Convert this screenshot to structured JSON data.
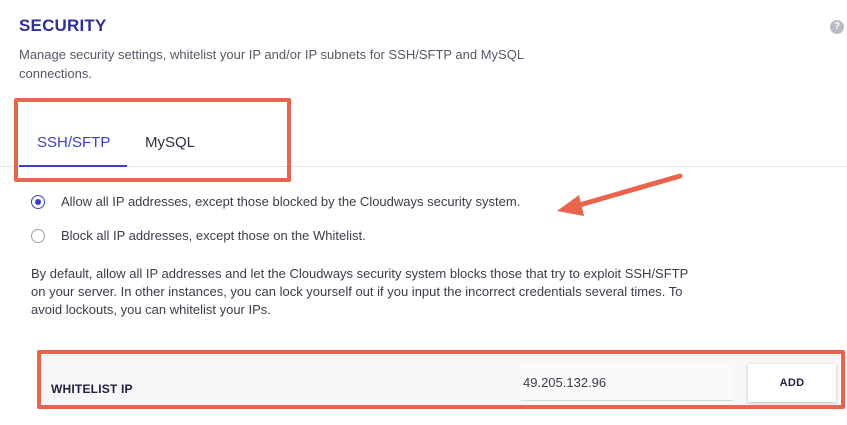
{
  "header": {
    "title": "SECURITY",
    "help_icon": "question-mark-icon",
    "description": "Manage security settings, whitelist your IP and/or IP subnets for SSH/SFTP and MySQL connections."
  },
  "tabs": [
    {
      "label": "SSH/SFTP",
      "active": true
    },
    {
      "label": "MySQL",
      "active": false
    }
  ],
  "access_options": [
    {
      "label": "Allow all IP addresses, except those blocked by the Cloudways security system.",
      "selected": true
    },
    {
      "label": "Block all IP addresses, except those on the Whitelist.",
      "selected": false
    }
  ],
  "info_text": "By default, allow all IP addresses and let the Cloudways security system blocks those that try to exploit SSH/SFTP on your server. In other instances, you can lock yourself out if you input the incorrect credentials several times. To avoid lockouts, you can whitelist your IPs.",
  "whitelist": {
    "label": "WHITELIST IP",
    "ip_value": "49.205.132.96",
    "add_label": "ADD"
  },
  "annotations": {
    "highlight_color": "#e8644c",
    "accent_color": "#3b40c6",
    "title_color": "#2d2f9a"
  }
}
